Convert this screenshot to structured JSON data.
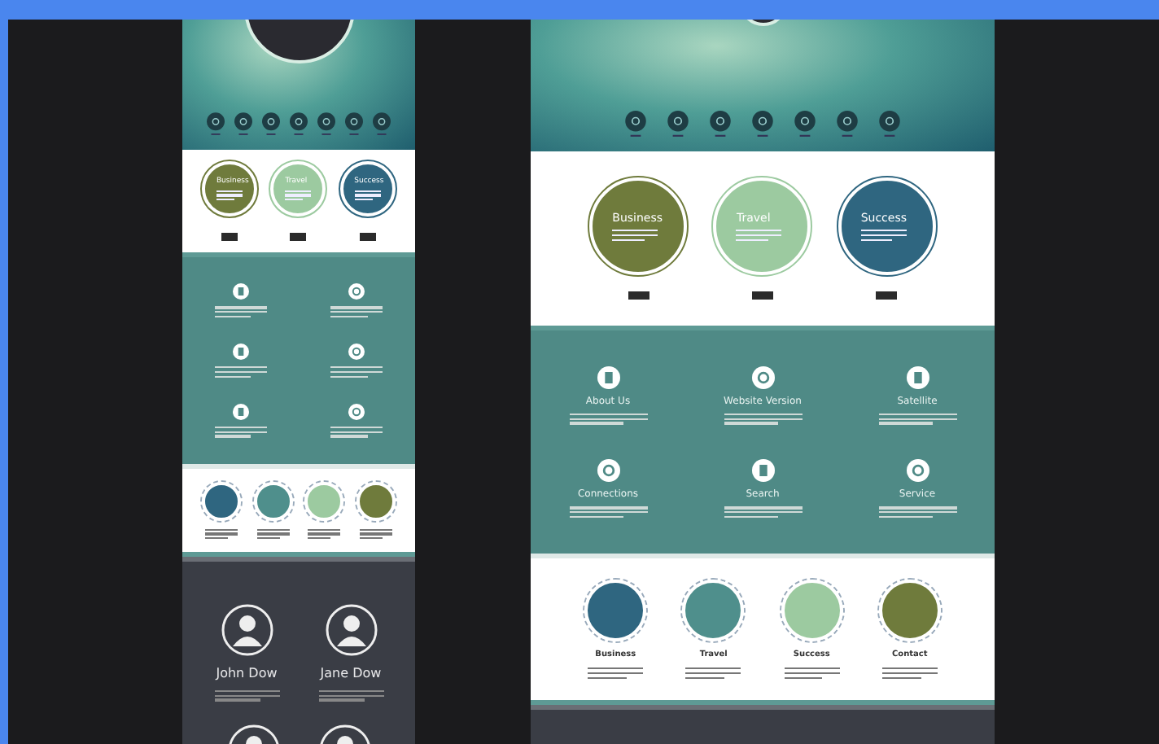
{
  "mobile_page": {
    "circles": [
      {
        "title": "Business",
        "color": "#6f7b3c"
      },
      {
        "title": "Travel",
        "color": "#9ccaa0"
      },
      {
        "title": "Success",
        "color": "#2f6680"
      }
    ],
    "swatches": [
      {
        "color": "#2f6680"
      },
      {
        "color": "#4f8f8c"
      },
      {
        "color": "#9ccaa0"
      },
      {
        "color": "#6f7b3c"
      }
    ],
    "team": [
      {
        "name": "John Dow"
      },
      {
        "name": "Jane Dow"
      }
    ]
  },
  "desktop_page": {
    "circles": [
      {
        "title": "Business",
        "color": "#6f7b3c"
      },
      {
        "title": "Travel",
        "color": "#9ccaa0"
      },
      {
        "title": "Success",
        "color": "#2f6680"
      }
    ],
    "services": [
      {
        "label": "About Us"
      },
      {
        "label": "Website Version"
      },
      {
        "label": "Satellite"
      },
      {
        "label": "Connections"
      },
      {
        "label": "Search"
      },
      {
        "label": "Service"
      }
    ],
    "swatches": [
      {
        "label": "Business",
        "color": "#2f6680"
      },
      {
        "label": "Travel",
        "color": "#4f8f8c"
      },
      {
        "label": "Success",
        "color": "#9ccaa0"
      },
      {
        "label": "Contact",
        "color": "#6f7b3c"
      }
    ]
  }
}
